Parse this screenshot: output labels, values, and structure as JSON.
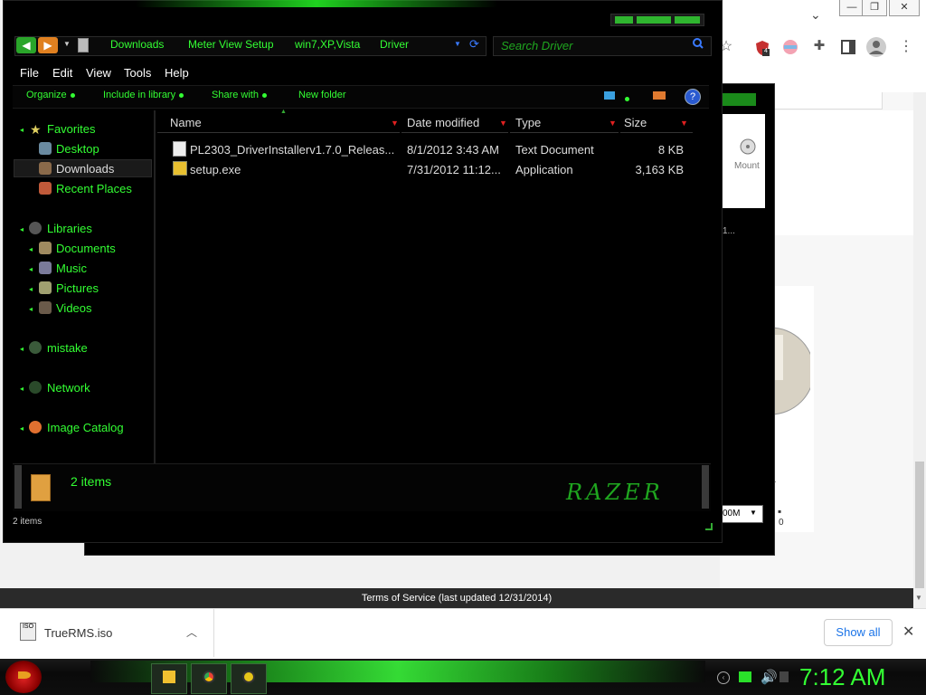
{
  "browser": {
    "terms_text": "Terms of Service (last updated 12/31/2014)",
    "download": {
      "filename": "TrueRMS.iso",
      "show_all_label": "Show all",
      "icon_text": "ISO"
    },
    "extension_badge": "4"
  },
  "back_window": {
    "mount_label": "Mount",
    "row_text": "1...",
    "combo_value": "00M",
    "side_text_1": "1",
    "side_text_2": "0"
  },
  "explorer": {
    "breadcrumbs": [
      "Downloads",
      "Meter View Setup",
      "win7,XP,Vista",
      "Driver"
    ],
    "search_placeholder": "Search Driver",
    "menu": [
      "File",
      "Edit",
      "View",
      "Tools",
      "Help"
    ],
    "commands": [
      "Organize",
      "Include in library",
      "Share with",
      "New folder"
    ],
    "help_label": "?",
    "nav": {
      "favorites": {
        "label": "Favorites",
        "items": [
          "Desktop",
          "Downloads",
          "Recent Places"
        ]
      },
      "libraries": {
        "label": "Libraries",
        "items": [
          "Documents",
          "Music",
          "Pictures",
          "Videos"
        ]
      },
      "mistake": "mistake",
      "network": "Network",
      "image_catalog": "Image Catalog"
    },
    "columns": [
      "Name",
      "Date modified",
      "Type",
      "Size"
    ],
    "files": [
      {
        "name": "PL2303_DriverInstallerv1.7.0_Releas...",
        "date": "8/1/2012 3:43 AM",
        "type": "Text Document",
        "size": "8 KB"
      },
      {
        "name": "setup.exe",
        "date": "7/31/2012 11:12...",
        "type": "Application",
        "size": "3,163 KB"
      }
    ],
    "status_count": "2 items",
    "statusline": "2 items",
    "logo_text": "RAZER"
  },
  "taskbar": {
    "clock": "7:12 AM"
  },
  "colors": {
    "accent_green": "#33ff33",
    "background": "#000000"
  }
}
